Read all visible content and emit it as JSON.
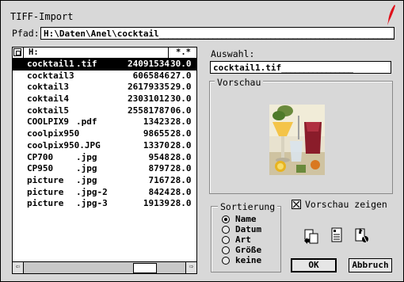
{
  "title": "TIFF-Import",
  "path": {
    "label": "Pfad:",
    "value": "H:\\Daten\\Anel\\cocktail",
    "fill": "______________________________________________________"
  },
  "list": {
    "header_path": "H:",
    "header_mask": "*.*",
    "rows": [
      {
        "name": "cocktail1",
        "ext": ".tif",
        "size": "24091534",
        "date": "30.0",
        "selected": true
      },
      {
        "name": "cocktail3",
        "ext": "",
        "size": "6065846",
        "date": "27.0"
      },
      {
        "name": "coktail3",
        "ext": "",
        "size": "26179335",
        "date": "29.0"
      },
      {
        "name": "coktail4",
        "ext": "",
        "size": "23031012",
        "date": "30.0"
      },
      {
        "name": "coktail5",
        "ext": "",
        "size": "25581787",
        "date": "06.0"
      },
      {
        "name": "COOLPIX9",
        "ext": ".pdf",
        "size": "13423",
        "date": "28.0"
      },
      {
        "name": "coolpix950",
        "ext": "",
        "size": "98655",
        "date": "28.0"
      },
      {
        "name": "coolpix950.JPG",
        "ext": "",
        "size": "13370",
        "date": "28.0"
      },
      {
        "name": "CP700",
        "ext": ".jpg",
        "size": "9548",
        "date": "28.0"
      },
      {
        "name": "CP950",
        "ext": ".jpg",
        "size": "8797",
        "date": "28.0"
      },
      {
        "name": "picture",
        "ext": ".jpg",
        "size": "7167",
        "date": "28.0"
      },
      {
        "name": "picture",
        "ext": ".jpg-2",
        "size": "8424",
        "date": "28.0"
      },
      {
        "name": "picture",
        "ext": ".jpg-3",
        "size": "19139",
        "date": "28.0"
      }
    ]
  },
  "selection": {
    "label": "Auswahl:",
    "value": "cocktail1.tif",
    "fill": "________________"
  },
  "preview": {
    "label": "Vorschau"
  },
  "sort": {
    "label": "Sortierung",
    "options": [
      "Name",
      "Datum",
      "Art",
      "Größe",
      "keine"
    ],
    "selected": 0
  },
  "show_preview": {
    "label": "Vorschau zeigen",
    "checked": true
  },
  "buttons": {
    "ok": "OK",
    "cancel": "Abbruch"
  },
  "icons": [
    "copy-document-icon",
    "file-info-icon",
    "delete-file-icon"
  ],
  "colors": {
    "window_bg": "#d8d8d8",
    "selection_bg": "#000000",
    "feather": "#e0101a"
  }
}
